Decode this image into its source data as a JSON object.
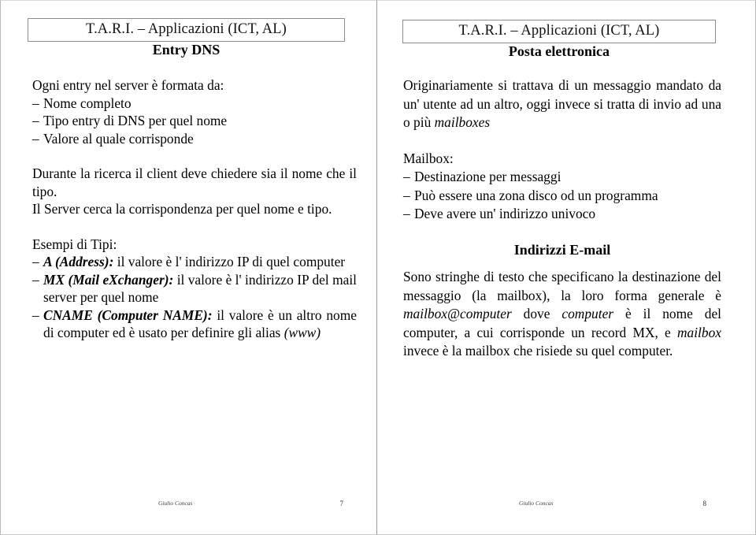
{
  "document": {
    "author_footer": "Giulio Concas"
  },
  "slides": [
    {
      "header": "T.A.R.I. – Applicazioni (ICT, AL)",
      "subtitle": "Entry DNS",
      "page_number": "7",
      "body": {
        "intro_line": "Ogni entry nel server è formata da:",
        "bullets": [
          "Nome completo",
          "Tipo entry di DNS per quel nome",
          "Valore al quale corrisponde"
        ],
        "para_ricerca": "Durante la ricerca il client deve chiedere sia il nome che il tipo.",
        "para_server": "Il Server cerca la corrispondenza per quel nome e tipo.",
        "esempi_label": "Esempi di Tipi:",
        "types": [
          {
            "term": "A (Address):",
            "definition": "il valore è l' indirizzo IP di quel computer"
          },
          {
            "term": "MX (Mail eXchanger):",
            "definition": "il valore è l'  indirizzo IP del mail server per quel nome"
          },
          {
            "term": "CNAME (Computer NAME):",
            "definition_pre": "il valore è un altro nome di computer ed è usato per definire gli alias ",
            "definition_italic": "(www)"
          }
        ]
      }
    },
    {
      "header": "T.A.R.I. – Applicazioni (ICT, AL)",
      "subtitle": "Posta elettronica",
      "page_number": "8",
      "body": {
        "para_origin_pre": "Originariamente si trattava di un messaggio mandato da un' utente ad un altro, oggi invece si tratta di invio ad una o più ",
        "para_origin_italic": "mailboxes",
        "mailbox_label": "Mailbox:",
        "mailbox_bullets": [
          "Destinazione per messaggi",
          "Può essere una zona disco od un programma",
          "Deve avere un'  indirizzo univoco"
        ],
        "indirizzi_heading": "Indirizzi E-mail",
        "para_indirizzi_1": "Sono stringhe di testo che specificano la destinazione del messaggio (la mailbox), la loro forma generale è ",
        "para_indirizzi_it1": "mailbox@computer",
        "para_indirizzi_2": " dove ",
        "para_indirizzi_it2": "computer",
        "para_indirizzi_3": " è il nome del computer, a cui corrisponde un record MX, e ",
        "para_indirizzi_it3": "mailbox",
        "para_indirizzi_4": " invece è la mailbox che risiede su quel computer."
      }
    }
  ]
}
